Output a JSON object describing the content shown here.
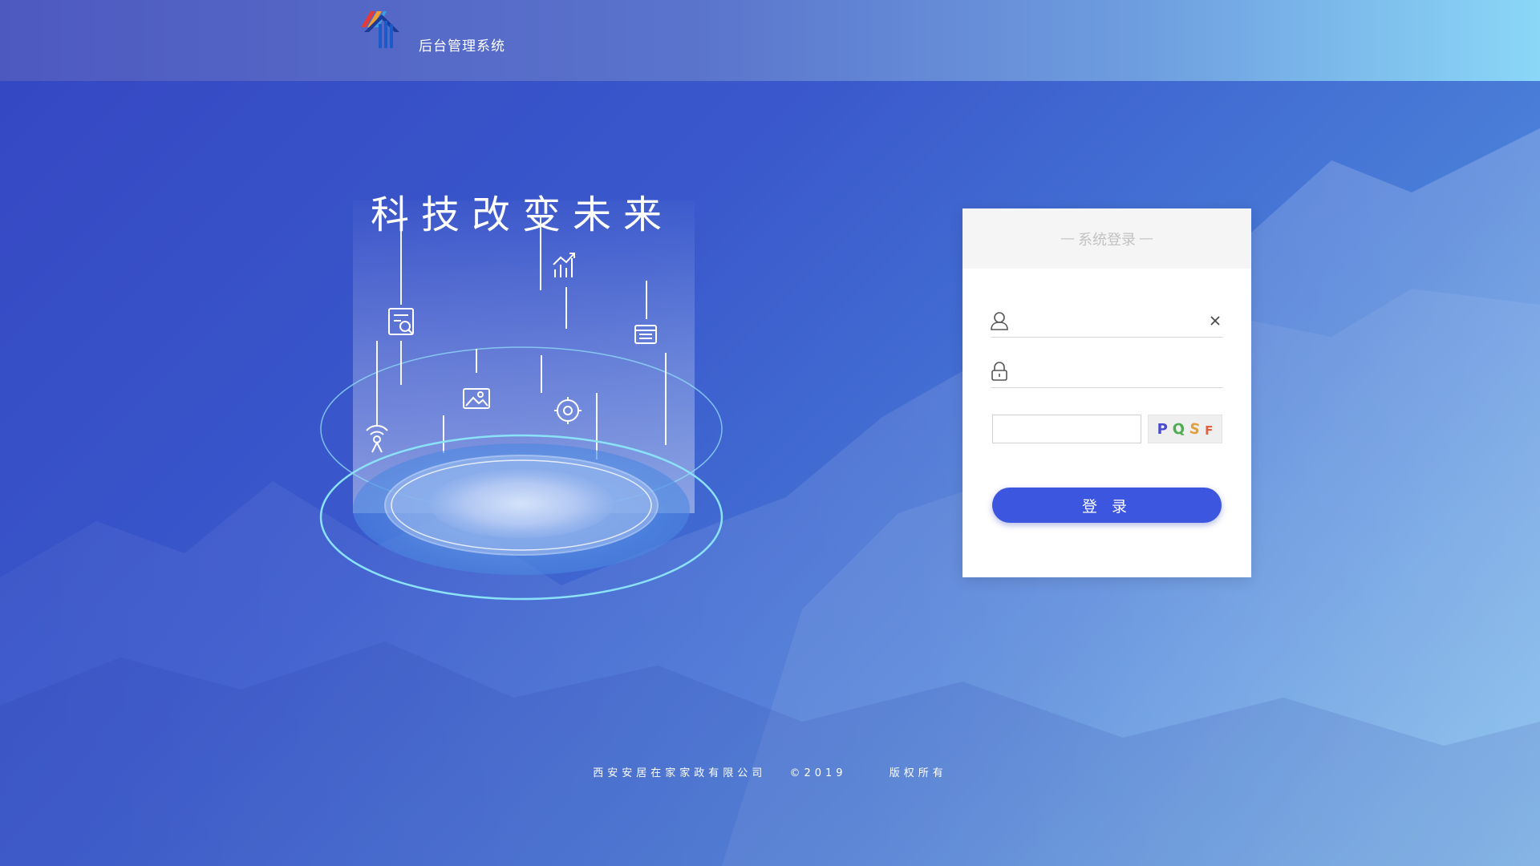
{
  "header": {
    "app_title": "后台管理系统",
    "logo_icon": "house-logo-icon"
  },
  "hero": {
    "slogan": "科技改变未来",
    "icons": [
      "document-search-icon",
      "chart-up-icon",
      "list-icon",
      "image-icon",
      "gear-icon",
      "broadcast-icon"
    ]
  },
  "login": {
    "title": "系统登录",
    "title_dash": "—",
    "username": {
      "value": "",
      "placeholder": "",
      "icon": "user-icon",
      "clear_icon": "close-icon"
    },
    "password": {
      "value": "",
      "placeholder": "",
      "icon": "lock-icon"
    },
    "captcha": {
      "value": "",
      "chars": [
        "P",
        "Q",
        "S",
        "F"
      ]
    },
    "submit_label": "登 录"
  },
  "footer": {
    "company": "西安安居在家家政有限公司",
    "copyright": "©2019",
    "rights": "版权所有"
  },
  "colors": {
    "primary": "#3d56e0",
    "header_start": "#4e59c0",
    "header_end": "#8ad7f7"
  }
}
